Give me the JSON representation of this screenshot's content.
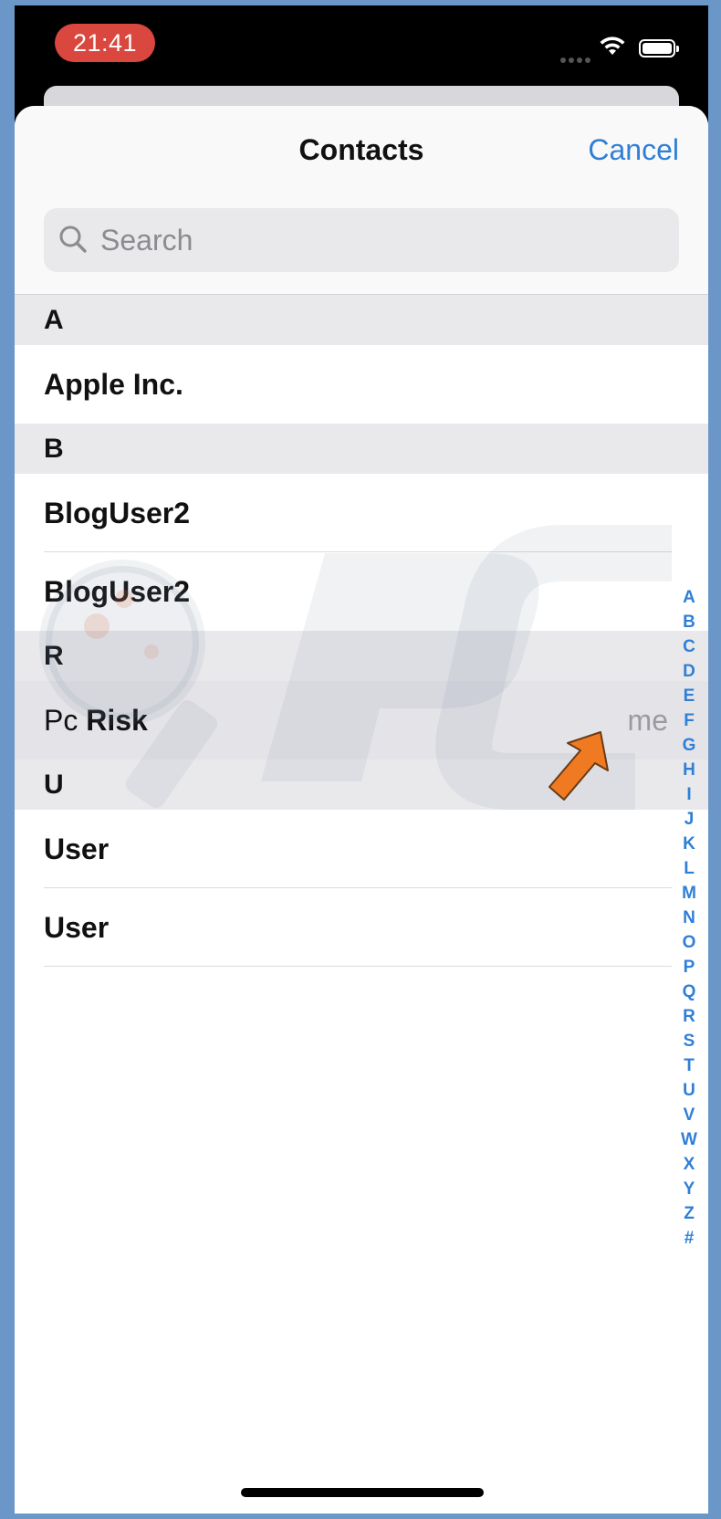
{
  "status_bar": {
    "time": "21:41"
  },
  "header": {
    "title": "Contacts",
    "cancel_label": "Cancel"
  },
  "search": {
    "placeholder": "Search",
    "value": ""
  },
  "sections": {
    "a": {
      "letter": "A",
      "rows": [
        "Apple Inc."
      ]
    },
    "b": {
      "letter": "B",
      "rows": [
        "BlogUser2",
        "BlogUser2"
      ]
    },
    "r": {
      "letter": "R",
      "me_contact": {
        "first": "Pc",
        "last": "Risk",
        "badge": "me"
      }
    },
    "u": {
      "letter": "U",
      "rows": [
        "User",
        "User"
      ]
    }
  },
  "index_letters": [
    "A",
    "B",
    "C",
    "D",
    "E",
    "F",
    "G",
    "H",
    "I",
    "J",
    "K",
    "L",
    "M",
    "N",
    "O",
    "P",
    "Q",
    "R",
    "S",
    "T",
    "U",
    "V",
    "W",
    "X",
    "Y",
    "Z",
    "#"
  ],
  "colors": {
    "accent": "#2f7fd6",
    "time_pill": "#d9473f",
    "section_bg": "#e9e9ec",
    "frame": "#6b96c8"
  }
}
